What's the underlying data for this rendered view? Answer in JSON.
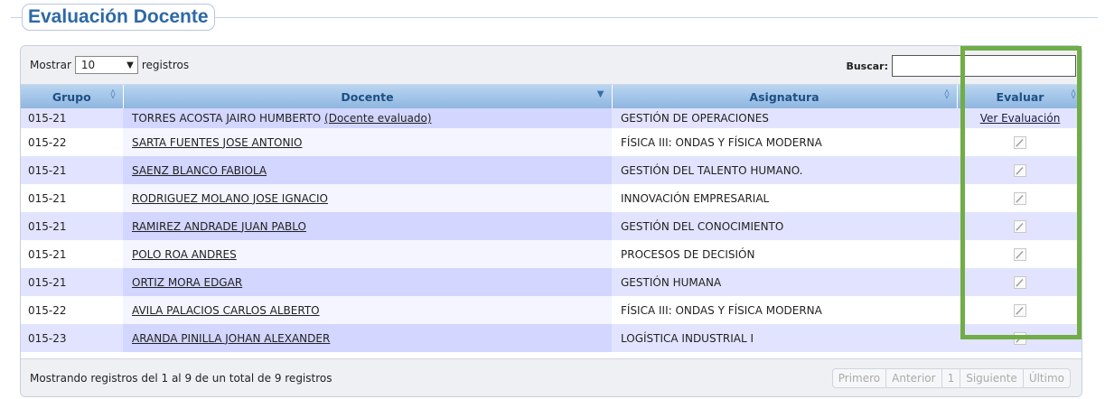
{
  "page": {
    "title": "Evaluación Docente"
  },
  "toolbar": {
    "show_prefix": "Mostrar",
    "show_value": "10",
    "show_suffix": "registros",
    "search_label": "Buscar:",
    "search_value": ""
  },
  "table": {
    "headers": {
      "grupo": "Grupo",
      "docente": "Docente",
      "asignatura": "Asignatura",
      "evaluar": "Evaluar"
    },
    "rows": [
      {
        "grupo": "015-21",
        "docente": "TORRES ACOSTA JAIRO HUMBERTO",
        "note": "(Docente evaluado)",
        "asignatura": "GESTIÓN DE OPERACIONES",
        "evaluar": "Ver Evaluación"
      },
      {
        "grupo": "015-22",
        "docente": "SARTA FUENTES JOSE ANTONIO",
        "asignatura": "FÍSICA III: ONDAS Y FÍSICA MODERNA",
        "evaluar_icon": "edit-icon"
      },
      {
        "grupo": "015-21",
        "docente": "SAENZ BLANCO FABIOLA",
        "asignatura": "GESTIÓN DEL TALENTO HUMANO.",
        "evaluar_icon": "edit-icon"
      },
      {
        "grupo": "015-21",
        "docente": "RODRIGUEZ MOLANO JOSE IGNACIO",
        "asignatura": "INNOVACIÓN EMPRESARIAL",
        "evaluar_icon": "edit-icon"
      },
      {
        "grupo": "015-21",
        "docente": "RAMIREZ ANDRADE JUAN PABLO",
        "asignatura": "GESTIÓN DEL CONOCIMIENTO",
        "evaluar_icon": "edit-icon"
      },
      {
        "grupo": "015-21",
        "docente": "POLO ROA ANDRES",
        "asignatura": "PROCESOS DE DECISIÓN",
        "evaluar_icon": "edit-icon"
      },
      {
        "grupo": "015-21",
        "docente": "ORTIZ MORA EDGAR",
        "asignatura": "GESTIÓN HUMANA",
        "evaluar_icon": "edit-icon"
      },
      {
        "grupo": "015-22",
        "docente": "AVILA PALACIOS CARLOS ALBERTO",
        "asignatura": "FÍSICA III: ONDAS Y FÍSICA MODERNA",
        "evaluar_icon": "edit-icon"
      },
      {
        "grupo": "015-23",
        "docente": "ARANDA PINILLA JOHAN ALEXANDER",
        "asignatura": "LOGÍSTICA INDUSTRIAL I",
        "evaluar_icon": "edit-icon"
      }
    ]
  },
  "footer": {
    "info": "Mostrando registros del 1 al 9 de un total de 9 registros",
    "pager": {
      "first": "Primero",
      "prev": "Anterior",
      "page": "1",
      "next": "Siguiente",
      "last": "Último"
    }
  },
  "colors": {
    "highlight": "#70ad47",
    "title": "#2d69a7",
    "odd_row": "#e2e4ff",
    "header": "#9dc1e6"
  }
}
